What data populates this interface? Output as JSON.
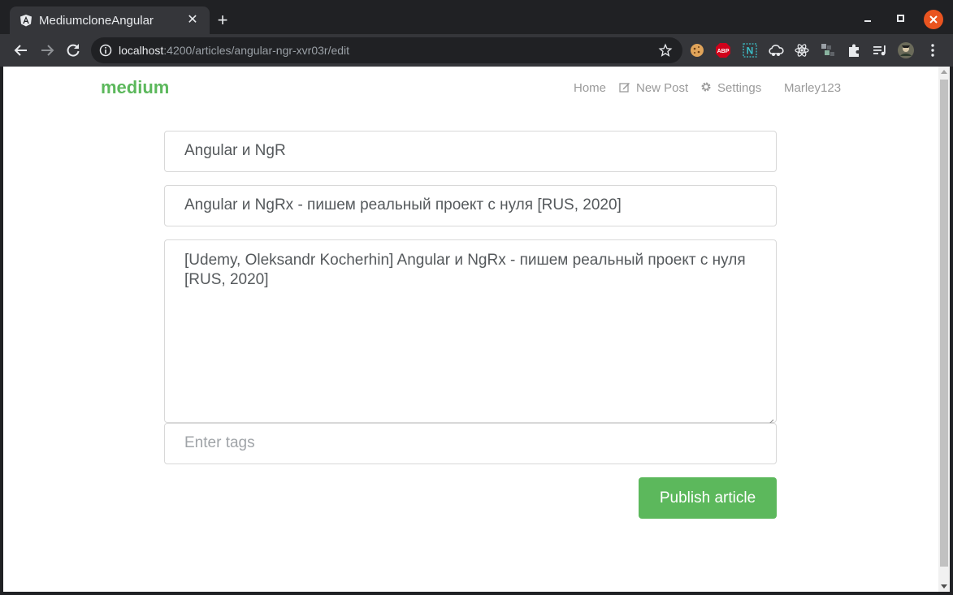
{
  "browser": {
    "tab_title": "MediumcloneAngular",
    "url_host": "localhost",
    "url_rest": ":4200/articles/angular-ngr-xvr03r/edit",
    "icons": [
      "angular-favicon-icon",
      "close-icon",
      "plus-icon",
      "minimize-icon",
      "maximize-icon",
      "window-close-icon",
      "back-arrow-icon",
      "forward-arrow-icon",
      "reload-icon",
      "info-icon",
      "star-icon",
      "cookie-extension-icon",
      "adblock-extension-icon",
      "ngrx-extension-icon",
      "cloud-extension-icon",
      "react-extension-icon",
      "redux-extension-icon",
      "puzzle-extensions-icon",
      "media-control-icon",
      "profile-avatar-icon",
      "kebab-menu-icon"
    ],
    "adblock_label": "ABP",
    "ngrx_label": "N"
  },
  "app": {
    "brand": "medium",
    "brand_color": "#5cb85c",
    "nav": {
      "home": "Home",
      "new_post": "New Post",
      "settings": "Settings",
      "user": "Marley123"
    }
  },
  "editor": {
    "title_value": "Angular и NgR",
    "description_value": "Angular и NgRx - пишем реальный проект с нуля [RUS, 2020]",
    "body_value": "[Udemy, Oleksandr Kocherhin] Angular и NgRx - пишем реальный проект с нуля [RUS, 2020]",
    "tags_placeholder": "Enter tags",
    "publish_label": "Publish article"
  }
}
